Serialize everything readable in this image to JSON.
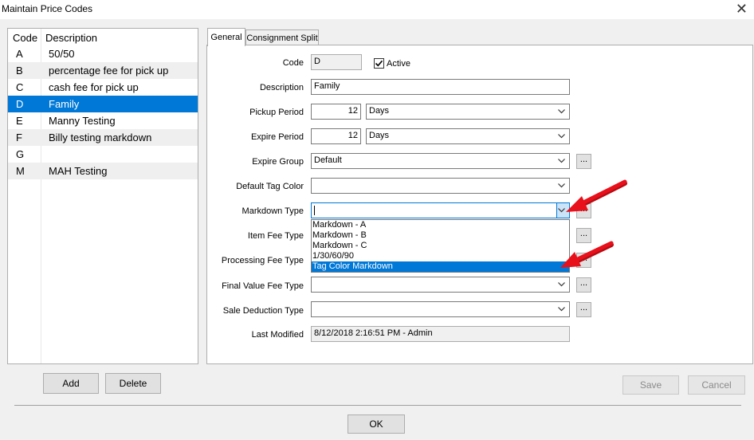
{
  "window": {
    "title": "Maintain Price Codes"
  },
  "list": {
    "columns": {
      "code": "Code",
      "description": "Description"
    },
    "rows": [
      {
        "code": "A",
        "description": "50/50"
      },
      {
        "code": "B",
        "description": "percentage fee for pick up"
      },
      {
        "code": "C",
        "description": "cash fee for pick up"
      },
      {
        "code": "D",
        "description": "Family"
      },
      {
        "code": "E",
        "description": "Manny Testing"
      },
      {
        "code": "F",
        "description": "Billy testing markdown"
      },
      {
        "code": "G",
        "description": ""
      },
      {
        "code": "M",
        "description": "MAH Testing"
      }
    ],
    "selected_code": "D"
  },
  "buttons": {
    "add": "Add",
    "delete": "Delete",
    "save": "Save",
    "cancel": "Cancel",
    "ok": "OK",
    "ellipsis": "..."
  },
  "tabs": {
    "general": "General",
    "consignment_split": "Consignment Split"
  },
  "form": {
    "code": {
      "label": "Code",
      "value": "D"
    },
    "active": {
      "label": "Active",
      "checked": true
    },
    "description": {
      "label": "Description",
      "value": "Family"
    },
    "pickup_period": {
      "label": "Pickup Period",
      "value": "12",
      "unit": "Days"
    },
    "expire_period": {
      "label": "Expire Period",
      "value": "12",
      "unit": "Days"
    },
    "expire_group": {
      "label": "Expire Group",
      "value": "Default"
    },
    "default_tag_color": {
      "label": "Default Tag Color",
      "value": ""
    },
    "markdown_type": {
      "label": "Markdown Type",
      "value": ""
    },
    "item_fee_type": {
      "label": "Item Fee Type",
      "value": ""
    },
    "processing_fee_type": {
      "label": "Processing Fee Type",
      "value": ""
    },
    "final_value_fee_type": {
      "label": "Final Value Fee Type",
      "value": ""
    },
    "sale_deduction_type": {
      "label": "Sale Deduction Type",
      "value": ""
    },
    "last_modified": {
      "label": "Last Modified",
      "value": "8/12/2018 2:16:51 PM - Admin"
    }
  },
  "markdown_dropdown": {
    "options": [
      "Markdown - A",
      "Markdown - B",
      "Markdown - C",
      "1/30/60/90",
      "Tag Color Markdown"
    ],
    "highlighted": "Tag Color Markdown"
  },
  "colors": {
    "selection": "#0078d7",
    "annotation_arrow": "#e8101a"
  }
}
